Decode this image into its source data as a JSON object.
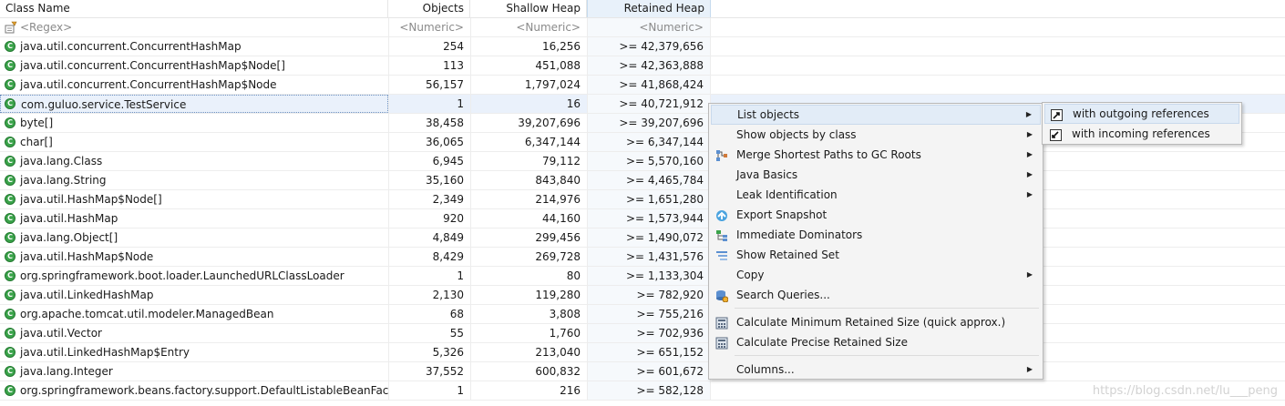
{
  "header": {
    "class_name": "Class Name",
    "objects": "Objects",
    "shallow_heap": "Shallow Heap",
    "retained_heap": "Retained Heap"
  },
  "filter": {
    "class_name": "<Regex>",
    "objects": "<Numeric>",
    "shallow_heap": "<Numeric>",
    "retained_heap": "<Numeric>"
  },
  "rows": [
    {
      "name": "java.util.concurrent.ConcurrentHashMap",
      "objects": "254",
      "shallow": "16,256",
      "retained": ">= 42,379,656"
    },
    {
      "name": "java.util.concurrent.ConcurrentHashMap$Node[]",
      "objects": "113",
      "shallow": "451,088",
      "retained": ">= 42,363,888"
    },
    {
      "name": "java.util.concurrent.ConcurrentHashMap$Node",
      "objects": "56,157",
      "shallow": "1,797,024",
      "retained": ">= 41,868,424"
    },
    {
      "name": "com.guluo.service.TestService",
      "objects": "1",
      "shallow": "16",
      "retained": ">= 40,721,912"
    },
    {
      "name": "byte[]",
      "objects": "38,458",
      "shallow": "39,207,696",
      "retained": ">= 39,207,696"
    },
    {
      "name": "char[]",
      "objects": "36,065",
      "shallow": "6,347,144",
      "retained": ">= 6,347,144"
    },
    {
      "name": "java.lang.Class",
      "objects": "6,945",
      "shallow": "79,112",
      "retained": ">= 5,570,160"
    },
    {
      "name": "java.lang.String",
      "objects": "35,160",
      "shallow": "843,840",
      "retained": ">= 4,465,784"
    },
    {
      "name": "java.util.HashMap$Node[]",
      "objects": "2,349",
      "shallow": "214,976",
      "retained": ">= 1,651,280"
    },
    {
      "name": "java.util.HashMap",
      "objects": "920",
      "shallow": "44,160",
      "retained": ">= 1,573,944"
    },
    {
      "name": "java.lang.Object[]",
      "objects": "4,849",
      "shallow": "299,456",
      "retained": ">= 1,490,072"
    },
    {
      "name": "java.util.HashMap$Node",
      "objects": "8,429",
      "shallow": "269,728",
      "retained": ">= 1,431,576"
    },
    {
      "name": "org.springframework.boot.loader.LaunchedURLClassLoader",
      "objects": "1",
      "shallow": "80",
      "retained": ">= 1,133,304"
    },
    {
      "name": "java.util.LinkedHashMap",
      "objects": "2,130",
      "shallow": "119,280",
      "retained": ">= 782,920"
    },
    {
      "name": "org.apache.tomcat.util.modeler.ManagedBean",
      "objects": "68",
      "shallow": "3,808",
      "retained": ">= 755,216"
    },
    {
      "name": "java.util.Vector",
      "objects": "55",
      "shallow": "1,760",
      "retained": ">= 702,936"
    },
    {
      "name": "java.util.LinkedHashMap$Entry",
      "objects": "5,326",
      "shallow": "213,040",
      "retained": ">= 651,152"
    },
    {
      "name": "java.lang.Integer",
      "objects": "37,552",
      "shallow": "600,832",
      "retained": ">= 601,672"
    },
    {
      "name": "org.springframework.beans.factory.support.DefaultListableBeanFac...",
      "objects": "1",
      "shallow": "216",
      "retained": ">= 582,128"
    }
  ],
  "context_menu": {
    "items": [
      {
        "label": "List objects",
        "submenu": true,
        "icon": ""
      },
      {
        "label": "Show objects by class",
        "submenu": true,
        "icon": ""
      },
      {
        "label": "Merge Shortest Paths to GC Roots",
        "submenu": true,
        "icon": "merge-paths-icon"
      },
      {
        "label": "Java Basics",
        "submenu": true,
        "icon": ""
      },
      {
        "label": "Leak Identification",
        "submenu": true,
        "icon": ""
      },
      {
        "label": "Export Snapshot",
        "submenu": false,
        "icon": "export-snapshot-icon"
      },
      {
        "label": "Immediate Dominators",
        "submenu": false,
        "icon": "immediate-dominators-icon"
      },
      {
        "label": "Show Retained Set",
        "submenu": false,
        "icon": "retained-set-icon"
      },
      {
        "label": "Copy",
        "submenu": true,
        "icon": ""
      },
      {
        "label": "Search Queries...",
        "submenu": false,
        "icon": "search-queries-icon"
      },
      {
        "label": "Calculate Minimum Retained Size (quick approx.)",
        "submenu": false,
        "icon": "calculator-icon"
      },
      {
        "label": "Calculate Precise Retained Size",
        "submenu": false,
        "icon": "calculator-icon"
      },
      {
        "label": "Columns...",
        "submenu": true,
        "icon": ""
      }
    ]
  },
  "submenu": {
    "items": [
      {
        "label": "with outgoing references",
        "icon": "outgoing-references-icon"
      },
      {
        "label": "with incoming references",
        "icon": "incoming-references-icon"
      }
    ]
  },
  "watermark": "https://blog.csdn.net/lu___peng",
  "colors": {
    "class_icon": "#3aa34a",
    "selection": "#eaf1fb",
    "menu_bg": "#f4f4f4",
    "menu_hover": "#e2ecf7"
  }
}
